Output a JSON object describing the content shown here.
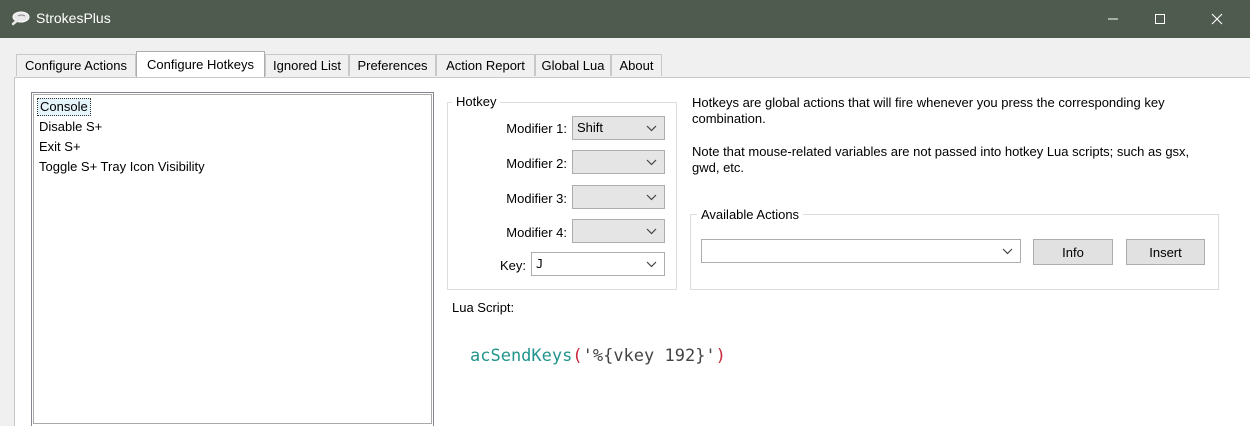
{
  "window": {
    "title": "StrokesPlus",
    "controls": [
      "minimize-icon",
      "maximize-icon",
      "close-icon"
    ]
  },
  "tabs": [
    {
      "label": "Configure Actions",
      "active": false
    },
    {
      "label": "Configure Hotkeys",
      "active": true
    },
    {
      "label": "Ignored List",
      "active": false
    },
    {
      "label": "Preferences",
      "active": false
    },
    {
      "label": "Action Report",
      "active": false
    },
    {
      "label": "Global Lua",
      "active": false
    },
    {
      "label": "About",
      "active": false
    }
  ],
  "hotkey_list": {
    "items": [
      "Console",
      "Disable S+",
      "Exit S+",
      "Toggle S+ Tray Icon Visibility"
    ],
    "selected_index": 0
  },
  "hotkey_group": {
    "label": "Hotkey",
    "modifier1_label": "Modifier 1:",
    "modifier1_value": "Shift",
    "modifier2_label": "Modifier 2:",
    "modifier2_value": "",
    "modifier3_label": "Modifier 3:",
    "modifier3_value": "",
    "modifier4_label": "Modifier 4:",
    "modifier4_value": "",
    "key_label": "Key:",
    "key_value": "J"
  },
  "description": {
    "line1": "Hotkeys are global actions that will fire whenever you press the corresponding key",
    "line2": "combination.",
    "line3": "Note that mouse-related variables are not passed into hotkey Lua scripts; such as gsx,",
    "line4": "gwd, etc."
  },
  "available_actions": {
    "label": "Available Actions",
    "selected": "",
    "info_label": "Info",
    "insert_label": "Insert"
  },
  "lua_script": {
    "label": "Lua Script:",
    "fn": "acSendKeys",
    "open": "(",
    "arg": "'%{vkey 192}'",
    "close": ")"
  },
  "colors": {
    "titlebar": "#4f5b4f",
    "code_function": "#21958d",
    "code_paren": "#c8283c"
  }
}
